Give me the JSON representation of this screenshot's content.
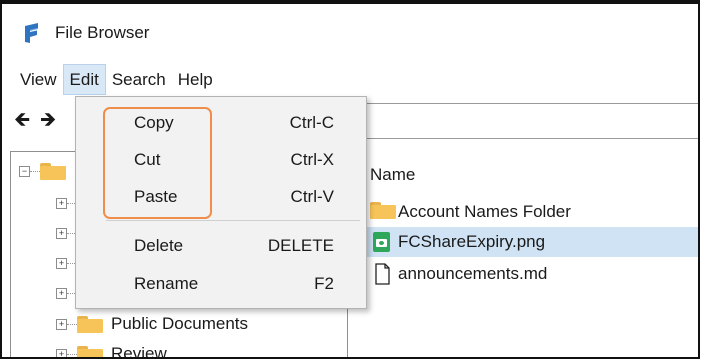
{
  "window": {
    "title": "File Browser",
    "app_icon": "file-browser-icon"
  },
  "menubar": {
    "items": [
      {
        "label": "View"
      },
      {
        "label": "Edit",
        "active": true
      },
      {
        "label": "Search"
      },
      {
        "label": "Help"
      }
    ]
  },
  "toolbar": {
    "back_icon": "back-arrow-icon",
    "forward_icon": "forward-arrow-icon"
  },
  "edit_menu": {
    "items": [
      {
        "label": "Copy",
        "shortcut": "Ctrl-C"
      },
      {
        "label": "Cut",
        "shortcut": "Ctrl-X"
      },
      {
        "label": "Paste",
        "shortcut": "Ctrl-V"
      },
      {
        "label": "Delete",
        "shortcut": "DELETE"
      },
      {
        "label": "Rename",
        "shortcut": "F2"
      }
    ],
    "highlight_color": "#ef8e4a"
  },
  "tree": {
    "items": [
      {
        "label": "Public Documents"
      },
      {
        "label": "Review"
      }
    ]
  },
  "file_list": {
    "column_header": "Name",
    "rows": [
      {
        "label": "Account Names Folder",
        "icon": "folder-icon",
        "selected": false
      },
      {
        "label": "FCShareExpiry.png",
        "icon": "image-file-icon",
        "selected": true
      },
      {
        "label": "announcements.md",
        "icon": "document-icon",
        "selected": false
      }
    ]
  },
  "colors": {
    "selection": "#cfe3f5",
    "menu_active": "#d9e8f7",
    "folder": "#f7c45a"
  }
}
